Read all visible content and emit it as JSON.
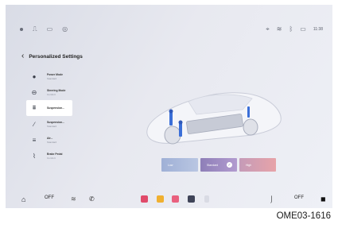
{
  "status_bar": {
    "left_icons": [
      "dot-icon",
      "usb-icon",
      "battery-card-icon",
      "globe-icon"
    ],
    "right_icons": [
      "gps-icon",
      "wifi-icon",
      "bluetooth-icon",
      "battery-icon"
    ],
    "time": "11:38"
  },
  "header": {
    "title": "Personalized Settings"
  },
  "menu": {
    "items": [
      {
        "label": "Power Mode",
        "sub": "Standard",
        "icon": "power-mode-icon"
      },
      {
        "label": "Steering Mode",
        "sub": "Comfort",
        "icon": "steering-icon"
      },
      {
        "label": "Suspension...",
        "sub": "",
        "icon": "suspension-icon"
      },
      {
        "label": "Suspension...",
        "sub": "Standard",
        "icon": "wrench-icon"
      },
      {
        "label": "Air...",
        "sub": "Standard",
        "icon": "air-icon"
      },
      {
        "label": "Brake Pedal",
        "sub": "Comfort",
        "icon": "brake-icon"
      }
    ]
  },
  "suspension_levels": {
    "low": "Low",
    "standard": "Standard",
    "high": "High",
    "selected": "Standard"
  },
  "dock": {
    "left_off": "OFF",
    "right_off": "OFF"
  },
  "caption": "OME03-1616",
  "colors": {
    "low": "#a9b8dc",
    "standard": "#9a88c2",
    "high": "#d7a0ae"
  }
}
